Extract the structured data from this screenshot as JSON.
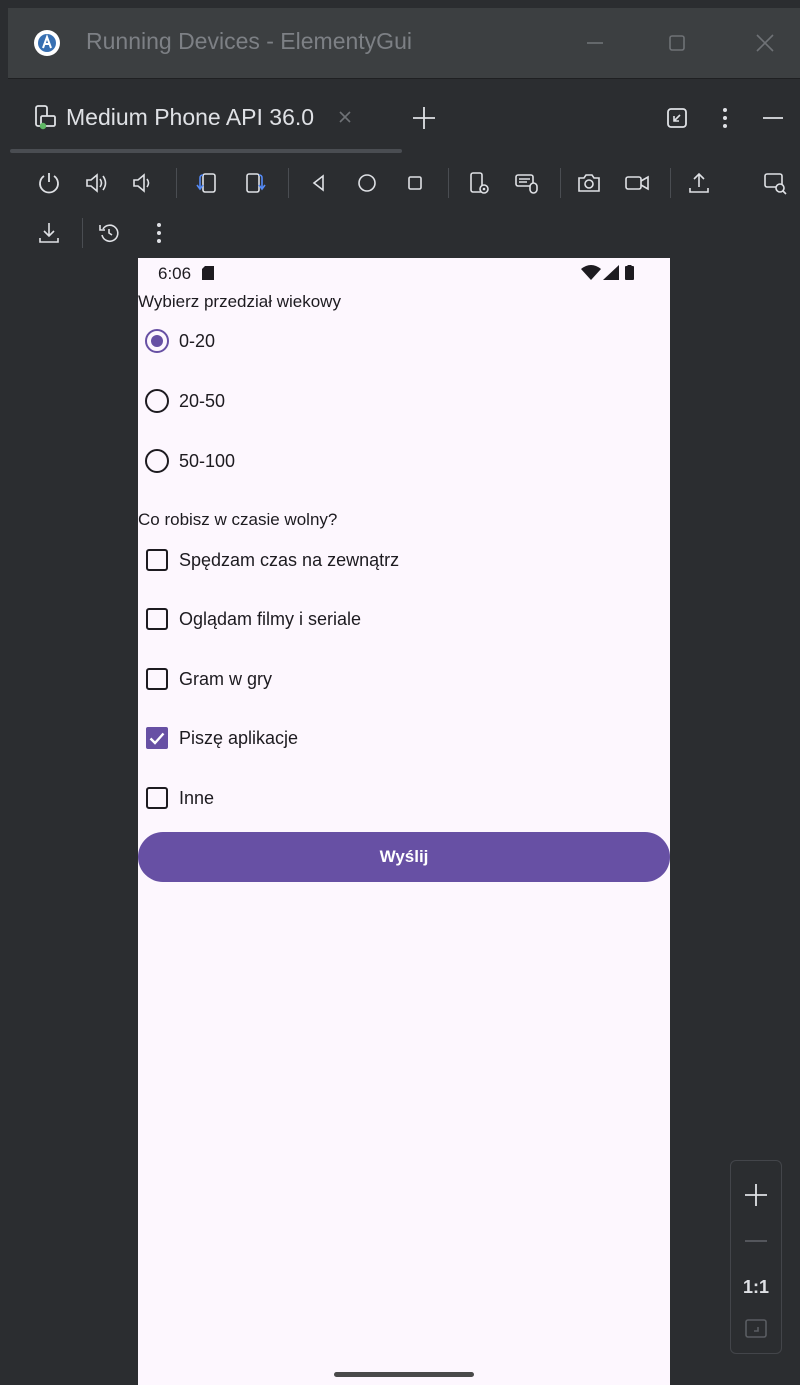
{
  "window": {
    "title": "Running Devices - ElementyGui"
  },
  "tabs": [
    {
      "label": "Medium Phone API 36.0"
    }
  ],
  "phone": {
    "status_time": "6:06",
    "age_question": "Wybierz przedział wiekowy",
    "age_options": [
      {
        "label": "0-20",
        "selected": true
      },
      {
        "label": "20-50",
        "selected": false
      },
      {
        "label": "50-100",
        "selected": false
      }
    ],
    "hobby_question": "Co robisz w czasie wolny?",
    "hobby_options": [
      {
        "label": "Spędzam czas na zewnątrz",
        "checked": false
      },
      {
        "label": "Oglądam filmy i seriale",
        "checked": false
      },
      {
        "label": "Gram w gry",
        "checked": false
      },
      {
        "label": "Piszę aplikacje",
        "checked": true
      },
      {
        "label": "Inne",
        "checked": false
      }
    ],
    "submit_label": "Wyślij"
  },
  "zoom": {
    "actual_size_label": "1:1"
  },
  "colors": {
    "accent": "#6750a4",
    "phone_background": "#fdf7fe",
    "ide_background": "#2b2d30",
    "titlebar_background": "#3c3f41",
    "icon_color": "#dfe1e5",
    "rotate_icon_color": "#548af7"
  },
  "icons": {
    "titlebar": [
      "android-studio-logo-icon",
      "minimize-icon",
      "maximize-icon",
      "close-icon"
    ],
    "tabbar": [
      "device-icon",
      "tab-close-icon",
      "add-tab-icon",
      "collapse-icon",
      "more-vertical-icon",
      "hide-icon"
    ],
    "toolbar": [
      "power-icon",
      "volume-up-icon",
      "volume-down-icon",
      "rotate-left-icon",
      "rotate-right-icon",
      "back-icon",
      "home-icon",
      "overview-icon",
      "device-settings-icon",
      "keyboard-mouse-icon",
      "screenshot-icon",
      "screen-record-icon",
      "upload-icon",
      "device-mirror-icon",
      "download-icon",
      "restore-snapshot-icon",
      "more-vertical-icon"
    ],
    "zoom": [
      "zoom-in-icon",
      "zoom-out-icon",
      "zoom-fit-icon"
    ]
  }
}
